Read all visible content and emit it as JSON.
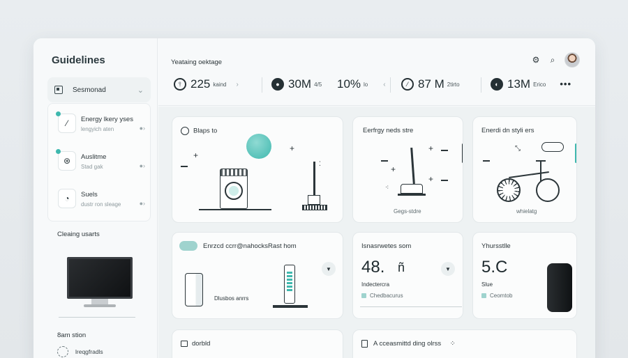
{
  "sidebar": {
    "brand": "Guidelines",
    "select_label": "Sesmonad",
    "items": [
      {
        "title": "Energy lkery yses",
        "subtitle": "lengyich aten"
      },
      {
        "title": "Auslitme",
        "subtitle": "Stad gak"
      },
      {
        "title": "Suels",
        "subtitle": "dustr ron sleage"
      }
    ],
    "cleaning_label": "Cleaing usarts",
    "station_label": "8am stion",
    "station_item": "lreqgfradls"
  },
  "header": {
    "subtitle": "Yeataing oektage",
    "stats": [
      {
        "value": "225",
        "unit": "kaind"
      },
      {
        "value": "30M",
        "unit": "4/5"
      },
      {
        "value": "10%",
        "unit": "lo"
      },
      {
        "value": "87 M",
        "unit": "2tirto"
      },
      {
        "value": "13M",
        "unit": "Erico"
      }
    ]
  },
  "cards": {
    "c1": {
      "title": "Blaps to"
    },
    "c2": {
      "title": "Eerfrgy neds stre",
      "caption": "Gegs-stdre"
    },
    "c3": {
      "title": "Enerdi dn styli ers",
      "caption": "whielatg"
    },
    "c4": {
      "title": "Enrzcd ccrr@nahocksRast hom",
      "caption": "Dlusbos anrrs"
    },
    "c5": {
      "title": "Isnasrwetes som",
      "value": "48.",
      "unit": "ñ",
      "caption": "Indectercra",
      "note": "Chedbacurus"
    },
    "c6": {
      "title": "Yhursstlle",
      "value": "5.C",
      "caption": "Slue",
      "note": "Ceomtob"
    },
    "c7": {
      "title": "dorbld"
    },
    "c8": {
      "title": "A cceasmittd ding olrss"
    }
  },
  "colors": {
    "accent": "#3fb8ae",
    "ink": "#253034"
  }
}
